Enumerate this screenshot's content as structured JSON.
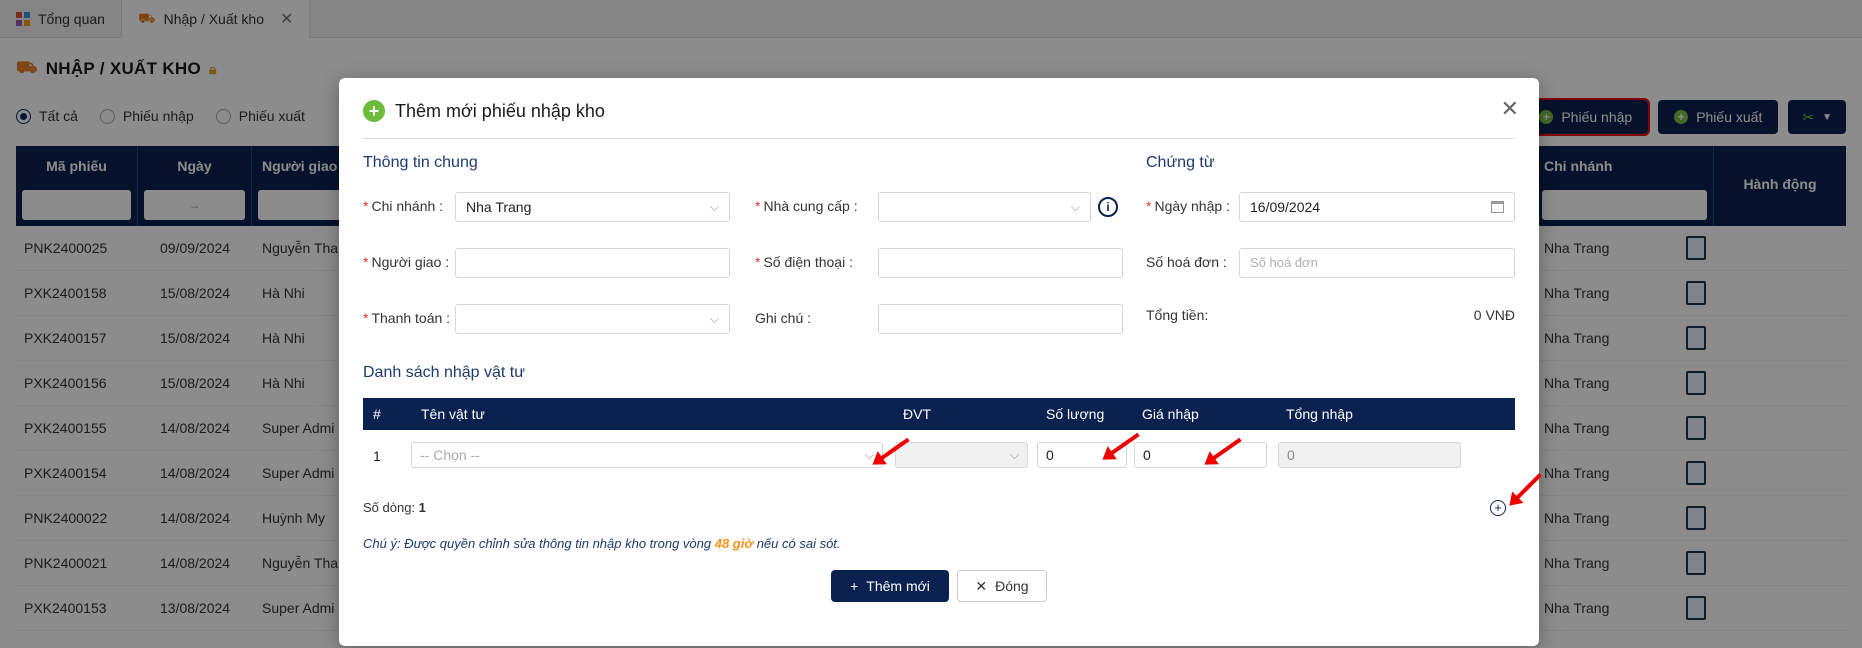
{
  "tabs": [
    {
      "label": "Tổng quan"
    },
    {
      "label": "Nhập / Xuất kho"
    }
  ],
  "page": {
    "title": "NHẬP / XUẤT KHO",
    "filters": [
      "Tất cả",
      "Phiếu nhập",
      "Phiếu xuất"
    ],
    "selected_filter": "Tất cả",
    "btn_import": "Phiếu nhập",
    "btn_export": "Phiếu xuất"
  },
  "table": {
    "headers": [
      "Mã phiếu",
      "Ngày",
      "Người giao",
      "Chi nhánh",
      "Hành động"
    ],
    "date_filter_separator": "→",
    "rows": [
      {
        "code": "PNK2400025",
        "date": "09/09/2024",
        "person": "Nguyễn Tha",
        "branch": "Nha Trang"
      },
      {
        "code": "PXK2400158",
        "date": "15/08/2024",
        "person": "Hà Nhi",
        "branch": "Nha Trang"
      },
      {
        "code": "PXK2400157",
        "date": "15/08/2024",
        "person": "Hà Nhi",
        "branch": "Nha Trang"
      },
      {
        "code": "PXK2400156",
        "date": "15/08/2024",
        "person": "Hà Nhi",
        "branch": "Nha Trang"
      },
      {
        "code": "PXK2400155",
        "date": "14/08/2024",
        "person": "Super Admi",
        "branch": "Nha Trang"
      },
      {
        "code": "PXK2400154",
        "date": "14/08/2024",
        "person": "Super Admi",
        "branch": "Nha Trang"
      },
      {
        "code": "PNK2400022",
        "date": "14/08/2024",
        "person": "Huỳnh My",
        "branch": "Nha Trang"
      },
      {
        "code": "PNK2400021",
        "date": "14/08/2024",
        "person": "Nguyễn Tha",
        "branch": "Nha Trang"
      },
      {
        "code": "PXK2400153",
        "date": "13/08/2024",
        "person": "Super Admi",
        "branch": "Nha Trang"
      }
    ]
  },
  "modal": {
    "title": "Thêm mới phiếu nhập kho",
    "section_general": "Thông tin chung",
    "section_docs": "Chứng từ",
    "branch_label": "Chi nhánh",
    "branch_value": "Nha Trang",
    "supplier_label": "Nhà cung cấp",
    "supplier_value": "",
    "deliverer_label": "Người giao",
    "phone_label": "Số điện thoại",
    "payment_label": "Thanh toán",
    "note_label": "Ghi chú",
    "import_date_label": "Ngày nhập",
    "import_date_value": "16/09/2024",
    "invoice_label": "Số hoá đơn",
    "invoice_placeholder": "Số hoá đơn",
    "total_label": "Tổng tiền:",
    "total_value": "0 VNĐ",
    "items_section": "Danh sách nhập vật tư",
    "items_headers": [
      "#",
      "Tên vật tư",
      "ĐVT",
      "Số lượng",
      "Giá nhập",
      "Tổng nhập"
    ],
    "item_row": {
      "idx": "1",
      "name_placeholder": "-- Chọn --",
      "qty": "0",
      "price": "0",
      "total": "0"
    },
    "row_count_label": "Số dòng:",
    "row_count": "1",
    "note_prefix": "Chú ý: Được quyền chỉnh sửa thông tin nhập kho trong vòng ",
    "note_highlight": "48 giờ",
    "note_suffix": " nếu có sai sót.",
    "btn_add": "Thêm mới",
    "btn_close": "Đóng"
  }
}
